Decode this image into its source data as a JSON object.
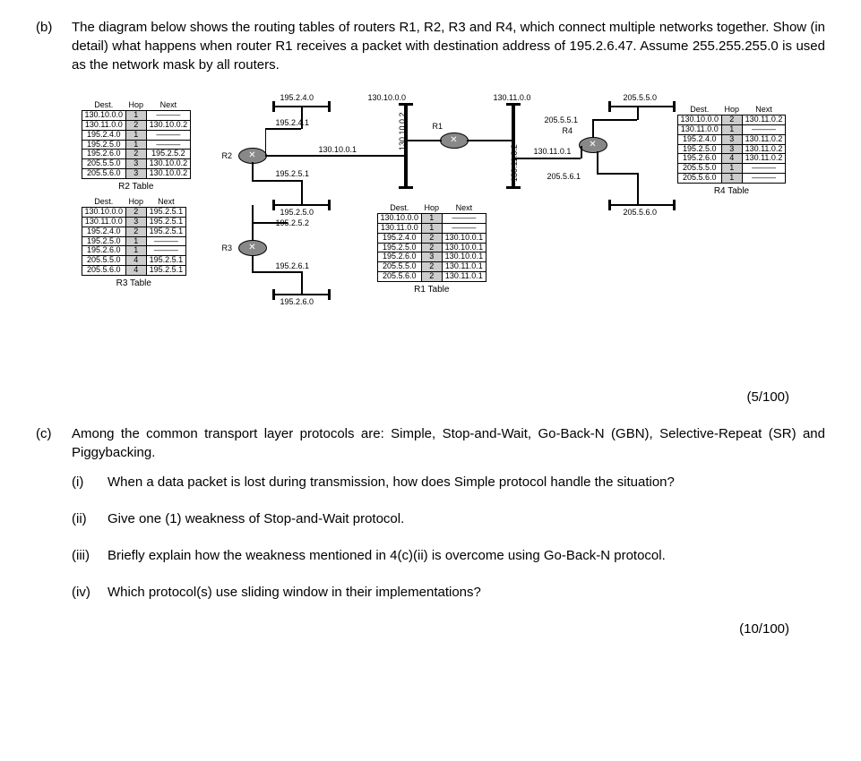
{
  "partB": {
    "label": "(b)",
    "text": "The diagram below shows the routing tables of routers R1, R2, R3 and R4, which connect multiple networks together. Show (in detail) what happens when router R1 receives a packet with destination address of 195.2.6.47. Assume 255.255.255.0 is used as the network mask by all routers."
  },
  "networks": {
    "n1": "195.2.4.0",
    "n2": "130.10.0.0",
    "n3": "130.11.0.0",
    "n4": "205.5.5.0",
    "n5": "195.2.5.0",
    "n6": "195.2.6.0",
    "n7": "205.5.6.0",
    "iv1": "130.10.0.2",
    "iv2": "130.11.0.2"
  },
  "interfaces": {
    "r2a": "195.2.4.1",
    "r2b": "130.10.0.1",
    "r2c": "195.2.5.1",
    "r3a": "195.2.5.2",
    "r3b": "195.2.6.1",
    "r4a": "205.5.5.1",
    "r4b": "130.11.0.1",
    "r4c": "205.5.6.1"
  },
  "routers": {
    "r1": "R1",
    "r2": "R2",
    "r3": "R3",
    "r4": "R4"
  },
  "headers": {
    "dest": "Dest.",
    "hop": "Hop",
    "next": "Next"
  },
  "r2table": {
    "label": "R2 Table",
    "rows": [
      [
        "130.10.0.0",
        "1",
        "———"
      ],
      [
        "130.11.0.0",
        "2",
        "130.10.0.2"
      ],
      [
        "195.2.4.0",
        "1",
        "———"
      ],
      [
        "195.2.5.0",
        "1",
        "———"
      ],
      [
        "195.2.6.0",
        "2",
        "195.2.5.2"
      ],
      [
        "205.5.5.0",
        "3",
        "130.10.0.2"
      ],
      [
        "205.5.6.0",
        "3",
        "130.10.0.2"
      ]
    ]
  },
  "r3table": {
    "label": "R3 Table",
    "rows": [
      [
        "130.10.0.0",
        "2",
        "195.2.5.1"
      ],
      [
        "130.11.0.0",
        "3",
        "195.2.5.1"
      ],
      [
        "195.2.4.0",
        "2",
        "195.2.5.1"
      ],
      [
        "195.2.5.0",
        "1",
        "———"
      ],
      [
        "195.2.6.0",
        "1",
        "———"
      ],
      [
        "205.5.5.0",
        "4",
        "195.2.5.1"
      ],
      [
        "205.5.6.0",
        "4",
        "195.2.5.1"
      ]
    ]
  },
  "r1table": {
    "label": "R1 Table",
    "rows": [
      [
        "130.10.0.0",
        "1",
        "———"
      ],
      [
        "130.11.0.0",
        "1",
        "———"
      ],
      [
        "195.2.4.0",
        "2",
        "130.10.0.1"
      ],
      [
        "195.2.5.0",
        "2",
        "130.10.0.1"
      ],
      [
        "195.2.6.0",
        "3",
        "130.10.0.1"
      ],
      [
        "205.5.5.0",
        "2",
        "130.11.0.1"
      ],
      [
        "205.5.6.0",
        "2",
        "130.11.0.1"
      ]
    ]
  },
  "r4table": {
    "label": "R4 Table",
    "rows": [
      [
        "130.10.0.0",
        "2",
        "130.11.0.2"
      ],
      [
        "130.11.0.0",
        "1",
        "———"
      ],
      [
        "195.2.4.0",
        "3",
        "130.11.0.2"
      ],
      [
        "195.2.5.0",
        "3",
        "130.11.0.2"
      ],
      [
        "195.2.6.0",
        "4",
        "130.11.0.2"
      ],
      [
        "205.5.5.0",
        "1",
        "———"
      ],
      [
        "205.5.6.0",
        "1",
        "———"
      ]
    ]
  },
  "scoreB": "(5/100)",
  "partC": {
    "label": "(c)",
    "text": "Among the common transport layer protocols are: Simple, Stop-and-Wait, Go-Back-N (GBN), Selective-Repeat (SR) and Piggybacking."
  },
  "c1": {
    "label": "(i)",
    "text": "When a data packet is lost during transmission, how does Simple protocol handle the situation?"
  },
  "c2": {
    "label": "(ii)",
    "text": "Give one (1) weakness of Stop-and-Wait protocol."
  },
  "c3": {
    "label": "(iii)",
    "text": "Briefly explain how the weakness mentioned in 4(c)(ii) is overcome using Go-Back-N protocol."
  },
  "c4": {
    "label": "(iv)",
    "text": "Which protocol(s) use sliding window in their implementations?"
  },
  "scoreC": "(10/100)"
}
